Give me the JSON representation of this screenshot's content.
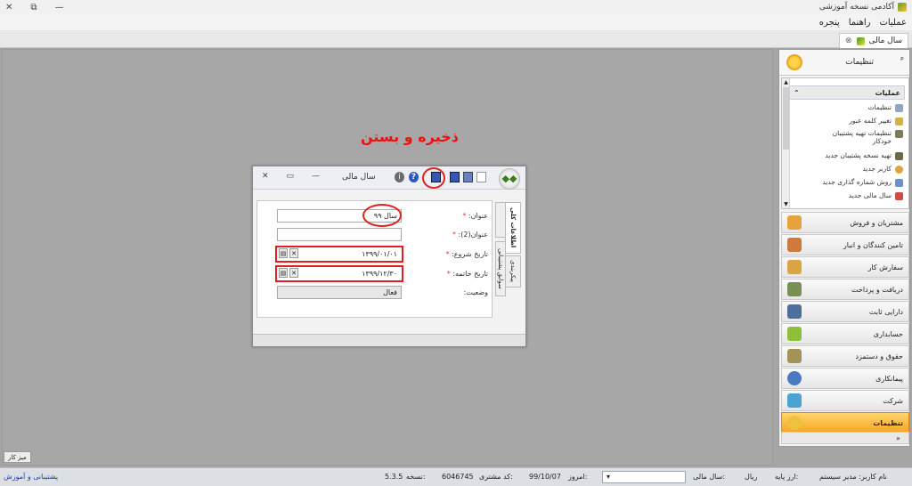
{
  "window": {
    "title": "آکادمی نسخه آموزشی",
    "controls": {
      "close": "✕",
      "maximize": "⧉",
      "minimize": "—"
    }
  },
  "menu": [
    "عملیات",
    "راهنما",
    "پنجره"
  ],
  "doc_tab": {
    "label": "سال مالی",
    "close": "⊗"
  },
  "annotation": "ذخیره و بستن",
  "dialog": {
    "caption": "سال مالی",
    "controls": {
      "close": "✕",
      "maximize": "▭",
      "minimize": "—"
    },
    "toolbar": [
      "new",
      "save-and-new",
      "save",
      "save-and-close",
      "help"
    ],
    "tabs": [
      "اطلاعات کلی",
      "پیکربندی"
    ],
    "side_tab": "سوابق پشتیبانی",
    "fields": {
      "title_label": "عنوان:",
      "title_value": "سال ۹۹",
      "title2_label": "عنوان(2):",
      "title2_value": "",
      "start_label": "تاریخ شروع:",
      "start_value": "۱۳۹۹/۰۱/۰۱",
      "end_label": "تاریخ خاتمه:",
      "end_value": "۱۳۹۹/۱۲/۳۰",
      "status_label": "وضعیت:",
      "status_value": "فعال"
    }
  },
  "nav": {
    "header": "تنظیمات",
    "pin": "ᵖ",
    "group": "عملیات",
    "items": [
      {
        "label": "تنظیمات",
        "icon": "settings-icon"
      },
      {
        "label": "تغییر کلمه عبور",
        "icon": "key-icon"
      },
      {
        "label": "تنظیمات تهیه پشتیبان خودکار",
        "icon": "backup-settings-icon"
      },
      {
        "label": "تهیه نسخه پشتیبان جدید",
        "icon": "backup-icon"
      },
      {
        "label": "کاربر جدید",
        "icon": "user-icon"
      },
      {
        "label": "روش شماره گذاری جدید",
        "icon": "numbering-icon"
      },
      {
        "label": "سال مالی جدید",
        "icon": "calendar-icon"
      }
    ],
    "buttons": [
      {
        "label": "مشتریان و فروش",
        "color": "#e7a23b"
      },
      {
        "label": "تامین کنندگان و انبار",
        "color": "#cf7a3d"
      },
      {
        "label": "سفارش کار",
        "color": "#d9a441"
      },
      {
        "label": "دریافت و پرداخت",
        "color": "#7a8f56"
      },
      {
        "label": "دارایی ثابت",
        "color": "#4e6f9a"
      },
      {
        "label": "حسابداری",
        "color": "#8ebf3a"
      },
      {
        "label": "حقوق و دستمزد",
        "color": "#a39359"
      },
      {
        "label": "پیمانکاری",
        "color": "#4a79c2"
      },
      {
        "label": "شرکت",
        "color": "#4aa3d0"
      },
      {
        "label": "تنظیمات",
        "color": "#f0c040",
        "active": true
      }
    ],
    "footer": "»"
  },
  "desktop_tab": "میز کار",
  "status": {
    "support": "پشتیبانی و آموزش",
    "version_label": "نسخه:",
    "version": "5.3.5",
    "customer_code_label": "کد مشتری:",
    "customer_code": "6046745",
    "today_label": "امروز:",
    "today": "99/10/07",
    "fiscal_year_label": "سال مالی:",
    "currency": "ریال",
    "base_currency_label": "ارز پایه:",
    "user_label": "نام کاربر: مدیر سیستم"
  }
}
